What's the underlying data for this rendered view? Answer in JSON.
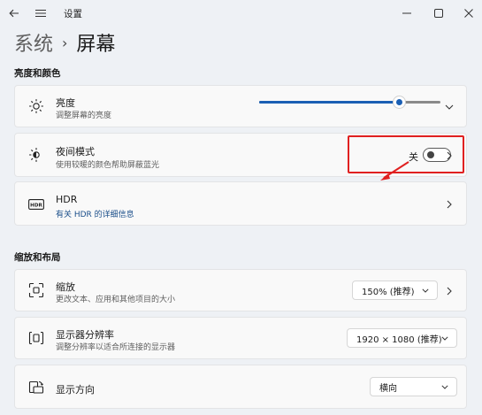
{
  "window": {
    "app_title": "设置"
  },
  "breadcrumb": {
    "parent": "系统",
    "separator": "›",
    "current": "屏幕"
  },
  "sections": {
    "brightness_color": "亮度和颜色",
    "scale_layout": "缩放和布局"
  },
  "brightness": {
    "label": "亮度",
    "desc": "调整屏幕的亮度",
    "value_fraction": 0.77
  },
  "night_light": {
    "label": "夜间模式",
    "desc": "使用较暖的颜色帮助屏蔽蓝光",
    "state": "关"
  },
  "hdr": {
    "label": "HDR",
    "desc": "有关 HDR 的详细信息",
    "icon_text": "HDR"
  },
  "scale": {
    "label": "缩放",
    "desc": "更改文本、应用和其他项目的大小",
    "value": "150% (推荐)"
  },
  "resolution": {
    "label": "显示器分辨率",
    "desc": "调整分辨率以适合所连接的显示器",
    "value": "1920 × 1080 (推荐)"
  },
  "orientation": {
    "label": "显示方向",
    "value": "横向"
  },
  "colors": {
    "accent": "#1a5fb4",
    "highlight": "#e02020",
    "background": "#eef1f5",
    "card": "#f9f9f9"
  }
}
